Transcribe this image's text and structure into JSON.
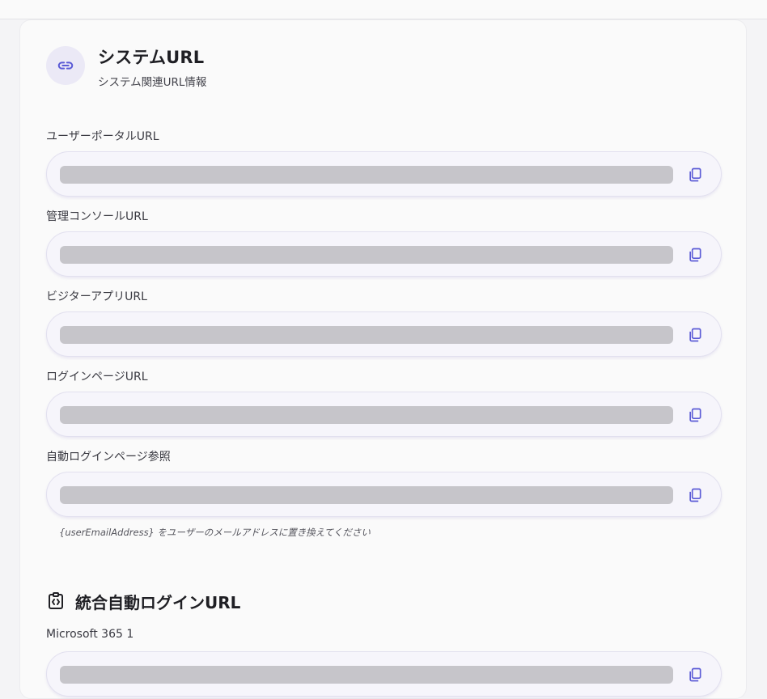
{
  "header": {
    "icon": "link-icon",
    "title": "システムURL",
    "subtitle": "システム関連URL情報"
  },
  "fields": [
    {
      "label": "ユーザーポータルURL",
      "value": "",
      "copy_icon": "copy-icon"
    },
    {
      "label": "管理コンソールURL",
      "value": "",
      "copy_icon": "copy-icon"
    },
    {
      "label": "ビジターアプリURL",
      "value": "",
      "copy_icon": "copy-icon"
    },
    {
      "label": "ログインページURL",
      "value": "",
      "copy_icon": "copy-icon"
    },
    {
      "label": "自動ログインページ参照",
      "value": "",
      "copy_icon": "copy-icon"
    }
  ],
  "hint": "{userEmailAddress} をユーザーのメールアドレスに置き換えてください",
  "integration": {
    "icon": "code-clipboard-icon",
    "title": "統合自動ログインURL",
    "fields": [
      {
        "label": "Microsoft 365 1",
        "value": "",
        "copy_icon": "copy-icon"
      }
    ]
  },
  "colors": {
    "accent": "#5b5bd6",
    "icon_bg": "#ebe9f6",
    "field_bg": "#f6f5fb",
    "redacted": "#c6c5ca"
  }
}
